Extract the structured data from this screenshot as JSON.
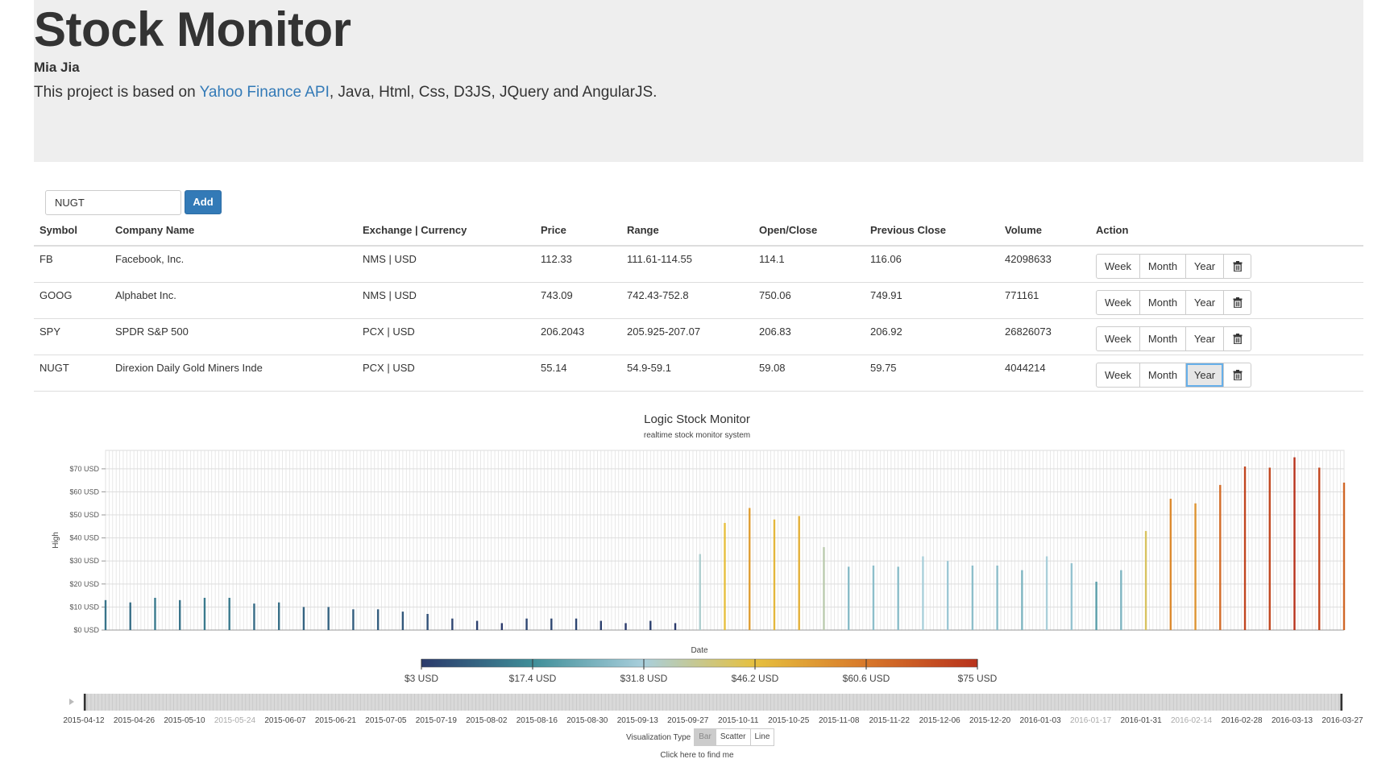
{
  "header": {
    "title": "Stock Monitor",
    "author": "Mia Jia",
    "desc_prefix": "This project is based on ",
    "desc_link": "Yahoo Finance API",
    "desc_suffix": ", Java, Html, Css, D3JS, JQuery and AngularJS."
  },
  "search": {
    "value": "NUGT",
    "add_label": "Add"
  },
  "table": {
    "headers": [
      "Symbol",
      "Company Name",
      "Exchange | Currency",
      "Price",
      "Range",
      "Open/Close",
      "Previous Close",
      "Volume",
      "Action"
    ],
    "rows": [
      [
        "FB",
        "Facebook, Inc.",
        "NMS | USD",
        "112.33",
        "111.61-114.55",
        "114.1",
        "116.06",
        "42098633"
      ],
      [
        "GOOG",
        "Alphabet Inc.",
        "NMS | USD",
        "743.09",
        "742.43-752.8",
        "750.06",
        "749.91",
        "771161"
      ],
      [
        "SPY",
        "SPDR S&P 500",
        "PCX | USD",
        "206.2043",
        "205.925-207.07",
        "206.83",
        "206.92",
        "26826073"
      ],
      [
        "NUGT",
        "Direxion Daily Gold Miners Inde",
        "PCX | USD",
        "55.14",
        "54.9-59.1",
        "59.08",
        "59.75",
        "4044214"
      ]
    ],
    "actions": {
      "week": "Week",
      "month": "Month",
      "year": "Year",
      "delete_icon": "trash-icon"
    },
    "active_action": {
      "row": 3,
      "button": "year"
    }
  },
  "chart_data": {
    "type": "bar",
    "title": "Logic Stock Monitor",
    "subtitle": "realtime stock monitor system",
    "xlabel": "Date",
    "ylabel": "High",
    "ylim": [
      0,
      78
    ],
    "y_ticks": [
      "$0 USD",
      "$10 USD",
      "$20 USD",
      "$30 USD",
      "$40 USD",
      "$50 USD",
      "$60 USD",
      "$70 USD"
    ],
    "x": [
      "2015-04-12",
      "2015-04-19",
      "2015-04-26",
      "2015-05-03",
      "2015-05-10",
      "2015-05-17",
      "2015-05-24",
      "2015-05-31",
      "2015-06-07",
      "2015-06-14",
      "2015-06-21",
      "2015-06-28",
      "2015-07-05",
      "2015-07-12",
      "2015-07-19",
      "2015-07-26",
      "2015-08-02",
      "2015-08-09",
      "2015-08-16",
      "2015-08-23",
      "2015-08-30",
      "2015-09-06",
      "2015-09-13",
      "2015-09-20",
      "2015-09-27",
      "2015-10-04",
      "2015-10-11",
      "2015-10-18",
      "2015-10-25",
      "2015-11-01",
      "2015-11-08",
      "2015-11-15",
      "2015-11-22",
      "2015-11-29",
      "2015-12-06",
      "2015-12-13",
      "2015-12-20",
      "2015-12-27",
      "2016-01-03",
      "2016-01-10",
      "2016-01-17",
      "2016-01-24",
      "2016-01-31",
      "2016-02-07",
      "2016-02-14",
      "2016-02-21",
      "2016-02-28",
      "2016-03-06",
      "2016-03-13",
      "2016-03-20",
      "2016-03-27"
    ],
    "values": [
      13,
      12,
      14,
      13,
      14,
      14,
      11.5,
      12,
      10,
      10,
      9,
      9,
      8,
      7,
      5,
      4,
      3,
      5,
      5,
      5,
      4,
      3,
      4,
      3,
      33,
      46.5,
      53,
      48,
      49.5,
      36,
      27.5,
      28,
      27.5,
      32,
      30,
      28,
      28,
      26,
      32,
      29,
      21,
      26,
      43,
      57,
      55,
      63,
      71,
      70.5,
      75,
      70.5,
      64
    ],
    "x_tick_labels": [
      "2015-04-12",
      "2015-04-26",
      "2015-05-10",
      "2015-05-24",
      "2015-06-07",
      "2015-06-21",
      "2015-07-05",
      "2015-07-19",
      "2015-08-02",
      "2015-08-16",
      "2015-08-30",
      "2015-09-13",
      "2015-09-27",
      "2015-10-11",
      "2015-10-25",
      "2015-11-08",
      "2015-11-22",
      "2015-12-06",
      "2015-12-20",
      "2016-01-03",
      "2016-01-17",
      "2016-01-31",
      "2016-02-14",
      "2016-02-28",
      "2016-03-13",
      "2016-03-27"
    ],
    "x_tick_dimmed": [
      "2015-05-24",
      "2016-01-17",
      "2016-02-14"
    ],
    "color_legend": [
      "$3 USD",
      "$17.4 USD",
      "$31.8 USD",
      "$46.2 USD",
      "$60.6 USD",
      "$75 USD"
    ],
    "color_scale": [
      "#2b3a6b",
      "#3f8e98",
      "#a9cfdc",
      "#e6c03e",
      "#d8782a",
      "#b8321c"
    ],
    "grid": true
  },
  "viz": {
    "label": "Visualization Type",
    "options": [
      "Bar",
      "Scatter",
      "Line"
    ],
    "active": "Bar",
    "find_me": "Click here to find me"
  }
}
